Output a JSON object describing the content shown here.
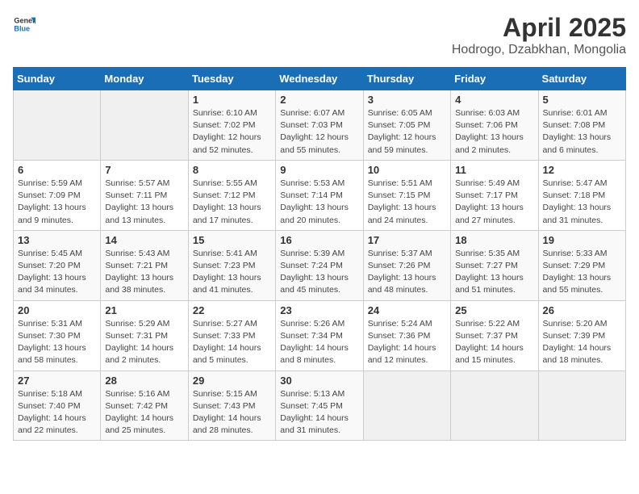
{
  "header": {
    "logo_general": "General",
    "logo_blue": "Blue",
    "title": "April 2025",
    "subtitle": "Hodrogo, Dzabkhan, Mongolia"
  },
  "days_of_week": [
    "Sunday",
    "Monday",
    "Tuesday",
    "Wednesday",
    "Thursday",
    "Friday",
    "Saturday"
  ],
  "weeks": [
    [
      {
        "day": "",
        "info": ""
      },
      {
        "day": "",
        "info": ""
      },
      {
        "day": "1",
        "info": "Sunrise: 6:10 AM\nSunset: 7:02 PM\nDaylight: 12 hours and 52 minutes."
      },
      {
        "day": "2",
        "info": "Sunrise: 6:07 AM\nSunset: 7:03 PM\nDaylight: 12 hours and 55 minutes."
      },
      {
        "day": "3",
        "info": "Sunrise: 6:05 AM\nSunset: 7:05 PM\nDaylight: 12 hours and 59 minutes."
      },
      {
        "day": "4",
        "info": "Sunrise: 6:03 AM\nSunset: 7:06 PM\nDaylight: 13 hours and 2 minutes."
      },
      {
        "day": "5",
        "info": "Sunrise: 6:01 AM\nSunset: 7:08 PM\nDaylight: 13 hours and 6 minutes."
      }
    ],
    [
      {
        "day": "6",
        "info": "Sunrise: 5:59 AM\nSunset: 7:09 PM\nDaylight: 13 hours and 9 minutes."
      },
      {
        "day": "7",
        "info": "Sunrise: 5:57 AM\nSunset: 7:11 PM\nDaylight: 13 hours and 13 minutes."
      },
      {
        "day": "8",
        "info": "Sunrise: 5:55 AM\nSunset: 7:12 PM\nDaylight: 13 hours and 17 minutes."
      },
      {
        "day": "9",
        "info": "Sunrise: 5:53 AM\nSunset: 7:14 PM\nDaylight: 13 hours and 20 minutes."
      },
      {
        "day": "10",
        "info": "Sunrise: 5:51 AM\nSunset: 7:15 PM\nDaylight: 13 hours and 24 minutes."
      },
      {
        "day": "11",
        "info": "Sunrise: 5:49 AM\nSunset: 7:17 PM\nDaylight: 13 hours and 27 minutes."
      },
      {
        "day": "12",
        "info": "Sunrise: 5:47 AM\nSunset: 7:18 PM\nDaylight: 13 hours and 31 minutes."
      }
    ],
    [
      {
        "day": "13",
        "info": "Sunrise: 5:45 AM\nSunset: 7:20 PM\nDaylight: 13 hours and 34 minutes."
      },
      {
        "day": "14",
        "info": "Sunrise: 5:43 AM\nSunset: 7:21 PM\nDaylight: 13 hours and 38 minutes."
      },
      {
        "day": "15",
        "info": "Sunrise: 5:41 AM\nSunset: 7:23 PM\nDaylight: 13 hours and 41 minutes."
      },
      {
        "day": "16",
        "info": "Sunrise: 5:39 AM\nSunset: 7:24 PM\nDaylight: 13 hours and 45 minutes."
      },
      {
        "day": "17",
        "info": "Sunrise: 5:37 AM\nSunset: 7:26 PM\nDaylight: 13 hours and 48 minutes."
      },
      {
        "day": "18",
        "info": "Sunrise: 5:35 AM\nSunset: 7:27 PM\nDaylight: 13 hours and 51 minutes."
      },
      {
        "day": "19",
        "info": "Sunrise: 5:33 AM\nSunset: 7:29 PM\nDaylight: 13 hours and 55 minutes."
      }
    ],
    [
      {
        "day": "20",
        "info": "Sunrise: 5:31 AM\nSunset: 7:30 PM\nDaylight: 13 hours and 58 minutes."
      },
      {
        "day": "21",
        "info": "Sunrise: 5:29 AM\nSunset: 7:31 PM\nDaylight: 14 hours and 2 minutes."
      },
      {
        "day": "22",
        "info": "Sunrise: 5:27 AM\nSunset: 7:33 PM\nDaylight: 14 hours and 5 minutes."
      },
      {
        "day": "23",
        "info": "Sunrise: 5:26 AM\nSunset: 7:34 PM\nDaylight: 14 hours and 8 minutes."
      },
      {
        "day": "24",
        "info": "Sunrise: 5:24 AM\nSunset: 7:36 PM\nDaylight: 14 hours and 12 minutes."
      },
      {
        "day": "25",
        "info": "Sunrise: 5:22 AM\nSunset: 7:37 PM\nDaylight: 14 hours and 15 minutes."
      },
      {
        "day": "26",
        "info": "Sunrise: 5:20 AM\nSunset: 7:39 PM\nDaylight: 14 hours and 18 minutes."
      }
    ],
    [
      {
        "day": "27",
        "info": "Sunrise: 5:18 AM\nSunset: 7:40 PM\nDaylight: 14 hours and 22 minutes."
      },
      {
        "day": "28",
        "info": "Sunrise: 5:16 AM\nSunset: 7:42 PM\nDaylight: 14 hours and 25 minutes."
      },
      {
        "day": "29",
        "info": "Sunrise: 5:15 AM\nSunset: 7:43 PM\nDaylight: 14 hours and 28 minutes."
      },
      {
        "day": "30",
        "info": "Sunrise: 5:13 AM\nSunset: 7:45 PM\nDaylight: 14 hours and 31 minutes."
      },
      {
        "day": "",
        "info": ""
      },
      {
        "day": "",
        "info": ""
      },
      {
        "day": "",
        "info": ""
      }
    ]
  ]
}
